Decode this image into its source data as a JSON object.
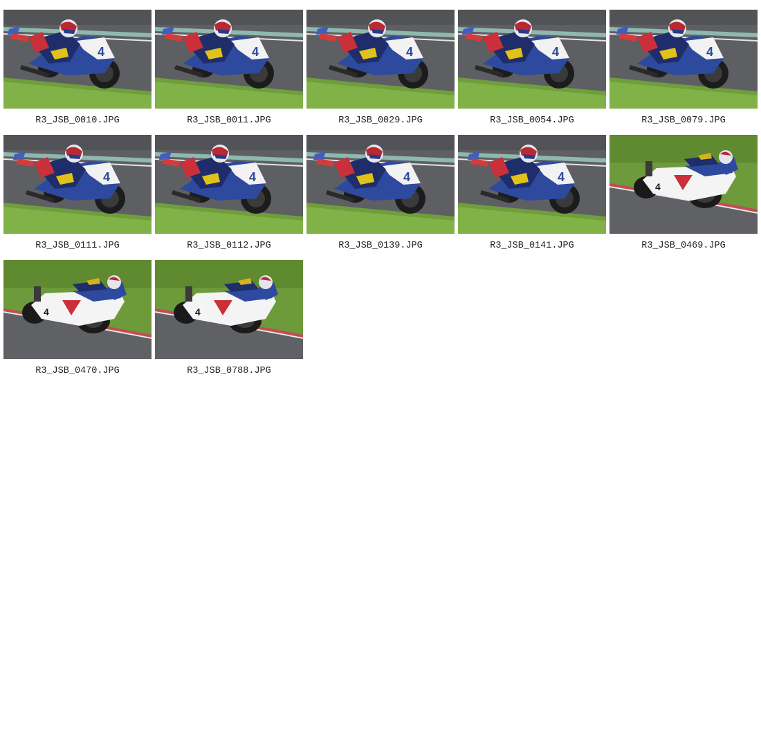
{
  "gallery": {
    "items": [
      {
        "filename": "R3_JSB_0010.JPG",
        "scene": "track-left"
      },
      {
        "filename": "R3_JSB_0011.JPG",
        "scene": "track-left"
      },
      {
        "filename": "R3_JSB_0029.JPG",
        "scene": "track-left"
      },
      {
        "filename": "R3_JSB_0054.JPG",
        "scene": "track-left"
      },
      {
        "filename": "R3_JSB_0079.JPG",
        "scene": "track-left"
      },
      {
        "filename": "R3_JSB_0111.JPG",
        "scene": "track-left"
      },
      {
        "filename": "R3_JSB_0112.JPG",
        "scene": "track-left"
      },
      {
        "filename": "R3_JSB_0139.JPG",
        "scene": "track-left"
      },
      {
        "filename": "R3_JSB_0141.JPG",
        "scene": "track-left"
      },
      {
        "filename": "R3_JSB_0469.JPG",
        "scene": "grass-right"
      },
      {
        "filename": "R3_JSB_0470.JPG",
        "scene": "grass-right"
      },
      {
        "filename": "R3_JSB_0788.JPG",
        "scene": "grass-right"
      }
    ]
  }
}
